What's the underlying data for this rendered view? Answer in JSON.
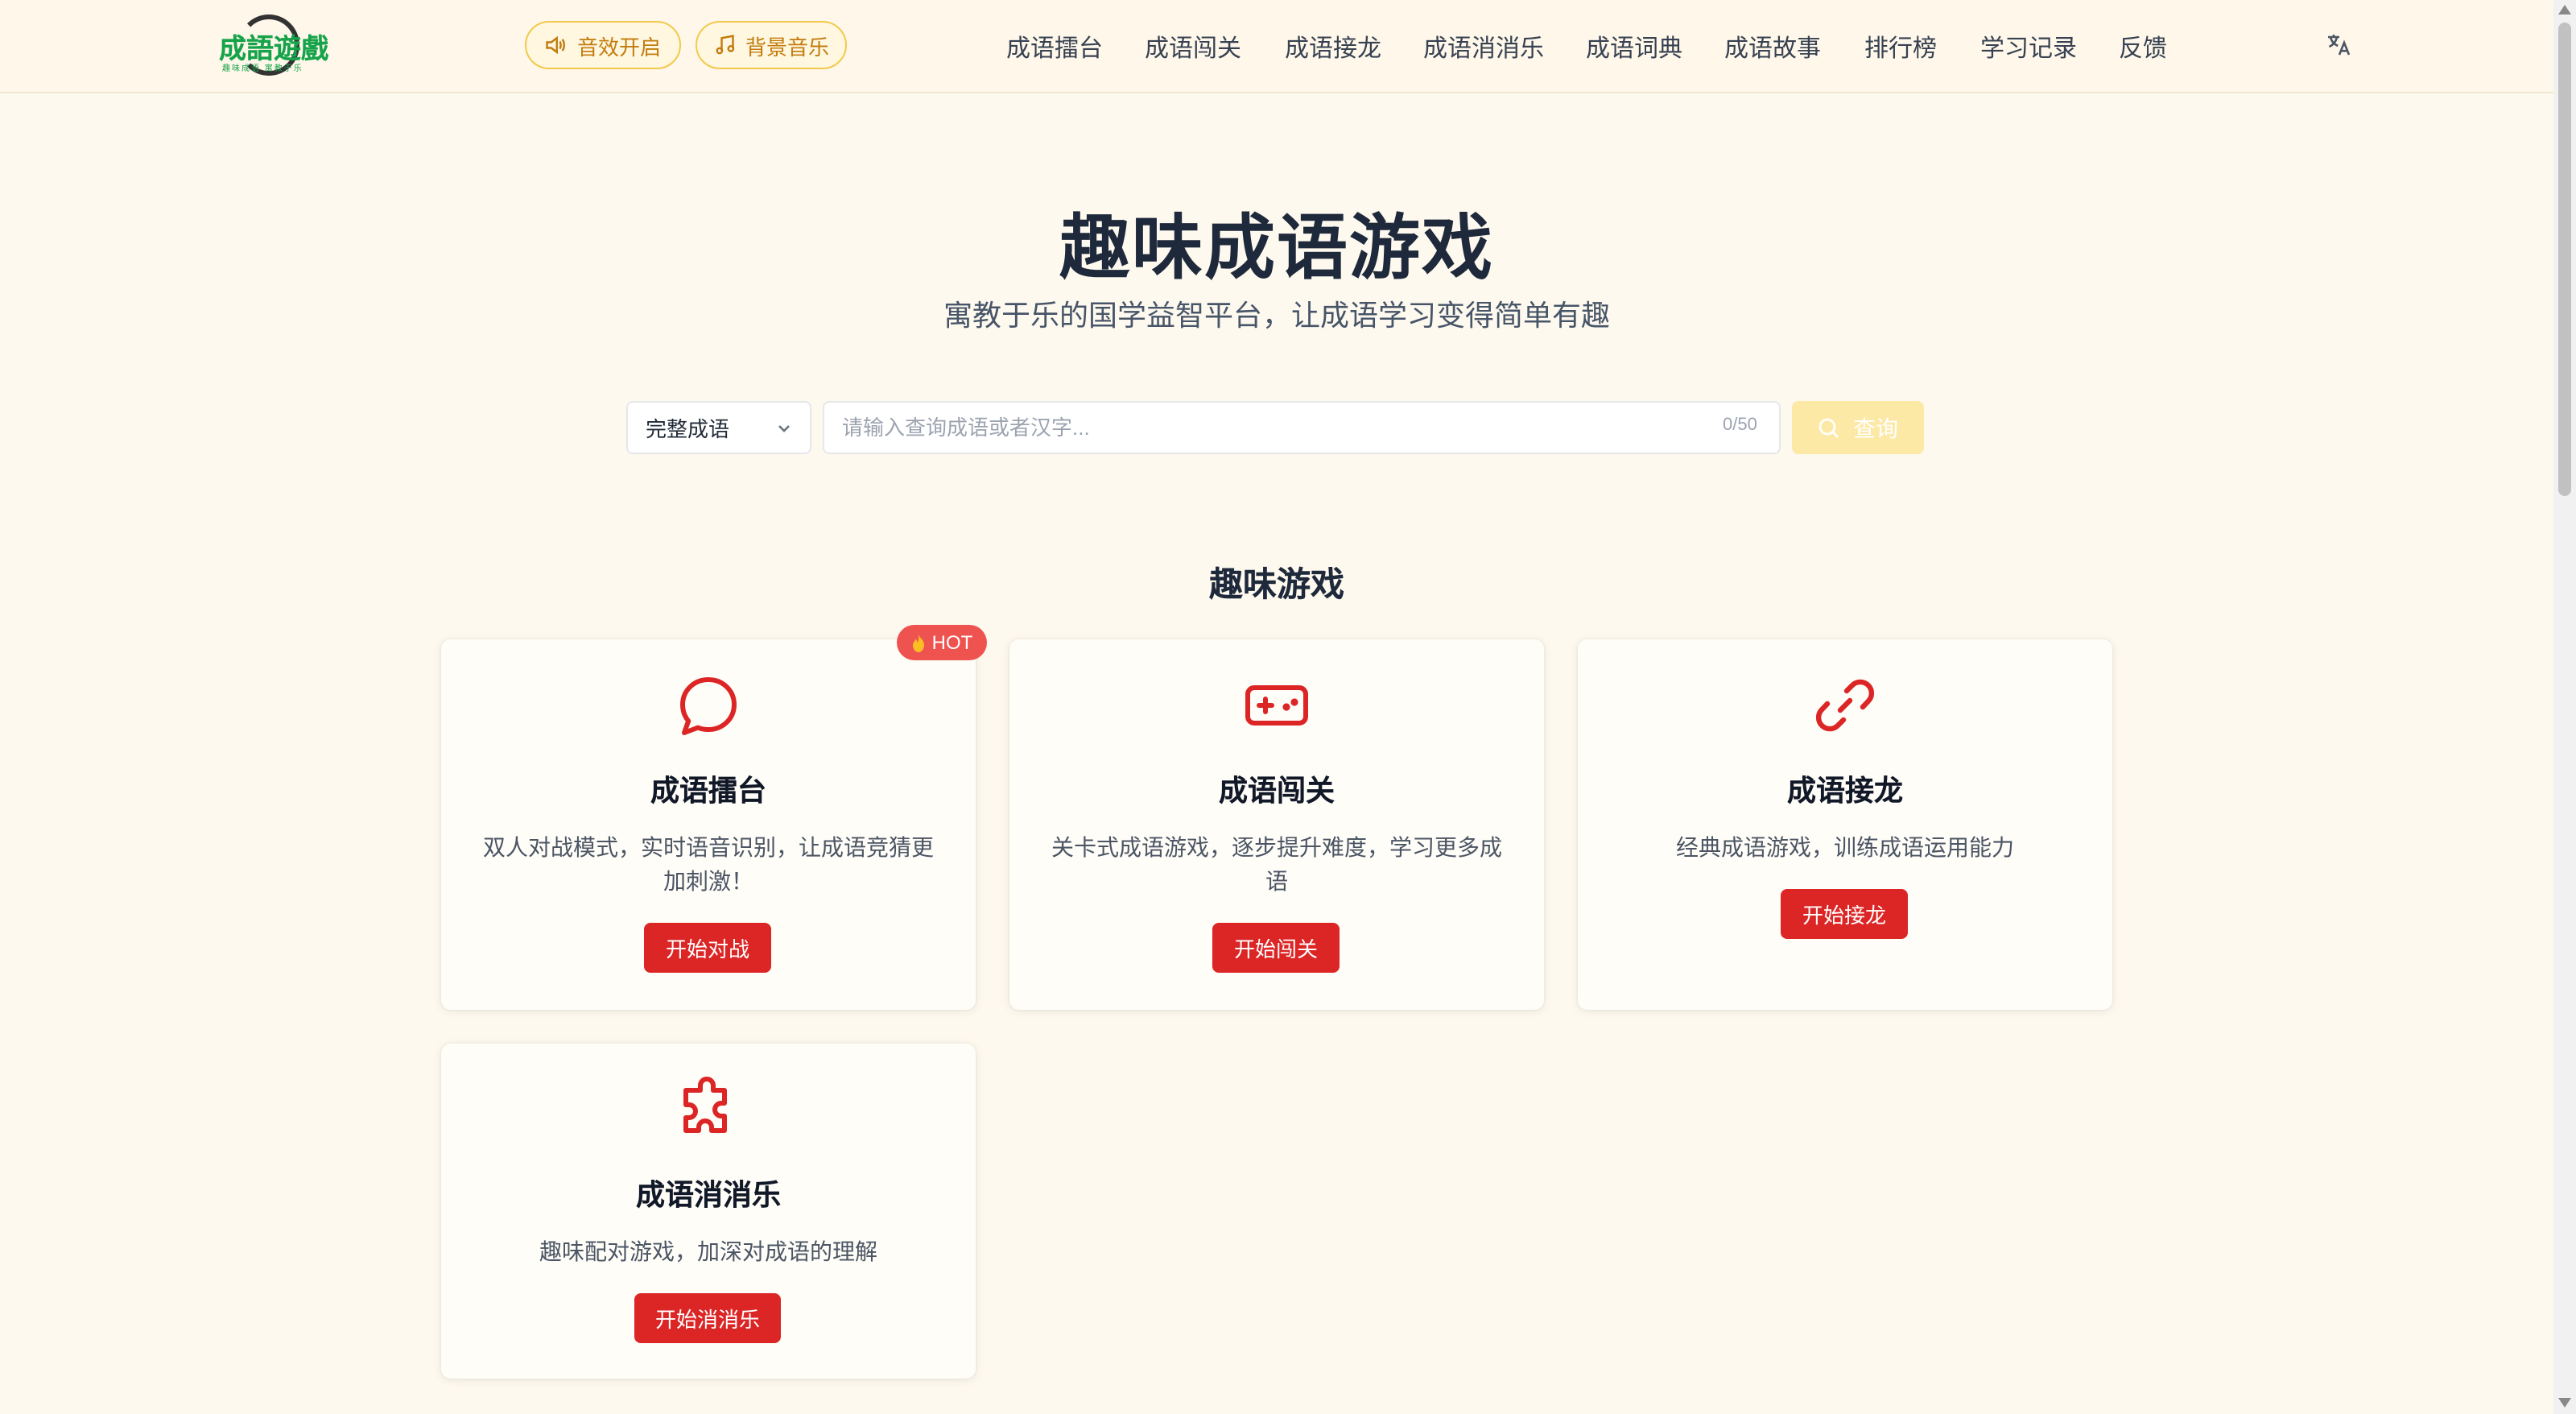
{
  "header": {
    "logo_text": "成語遊戲",
    "logo_sub": "趣味成语 寓教于乐",
    "sound_label": "音效开启",
    "music_label": "背景音乐",
    "nav": [
      "成语擂台",
      "成语闯关",
      "成语接龙",
      "成语消消乐",
      "成语词典",
      "成语故事",
      "排行榜",
      "学习记录",
      "反馈"
    ]
  },
  "hero": {
    "title": "趣味成语游戏",
    "subtitle": "寓教于乐的国学益智平台，让成语学习变得简单有趣"
  },
  "search": {
    "mode": "完整成语",
    "placeholder": "请输入查询成语或者汉字...",
    "count": "0/50",
    "button": "查询"
  },
  "games": {
    "section_title": "趣味游戏",
    "hot_label": "HOT",
    "cards": [
      {
        "title": "成语擂台",
        "desc": "双人对战模式，实时语音识别，让成语竞猜更加刺激！",
        "button": "开始对战",
        "icon": "chat-bubble-icon"
      },
      {
        "title": "成语闯关",
        "desc": "关卡式成语游戏，逐步提升难度，学习更多成语",
        "button": "开始闯关",
        "icon": "gamepad-icon"
      },
      {
        "title": "成语接龙",
        "desc": "经典成语游戏，训练成语运用能力",
        "button": "开始接龙",
        "icon": "link-icon"
      },
      {
        "title": "成语消消乐",
        "desc": "趣味配对游戏，加深对成语的理解",
        "button": "开始消消乐",
        "icon": "puzzle-icon"
      }
    ]
  },
  "colors": {
    "accent": "#dc2626",
    "background": "#fef9ee",
    "pill_border": "#f2c94c",
    "search_button": "#fde9a6",
    "hot_badge": "#ef5350"
  }
}
